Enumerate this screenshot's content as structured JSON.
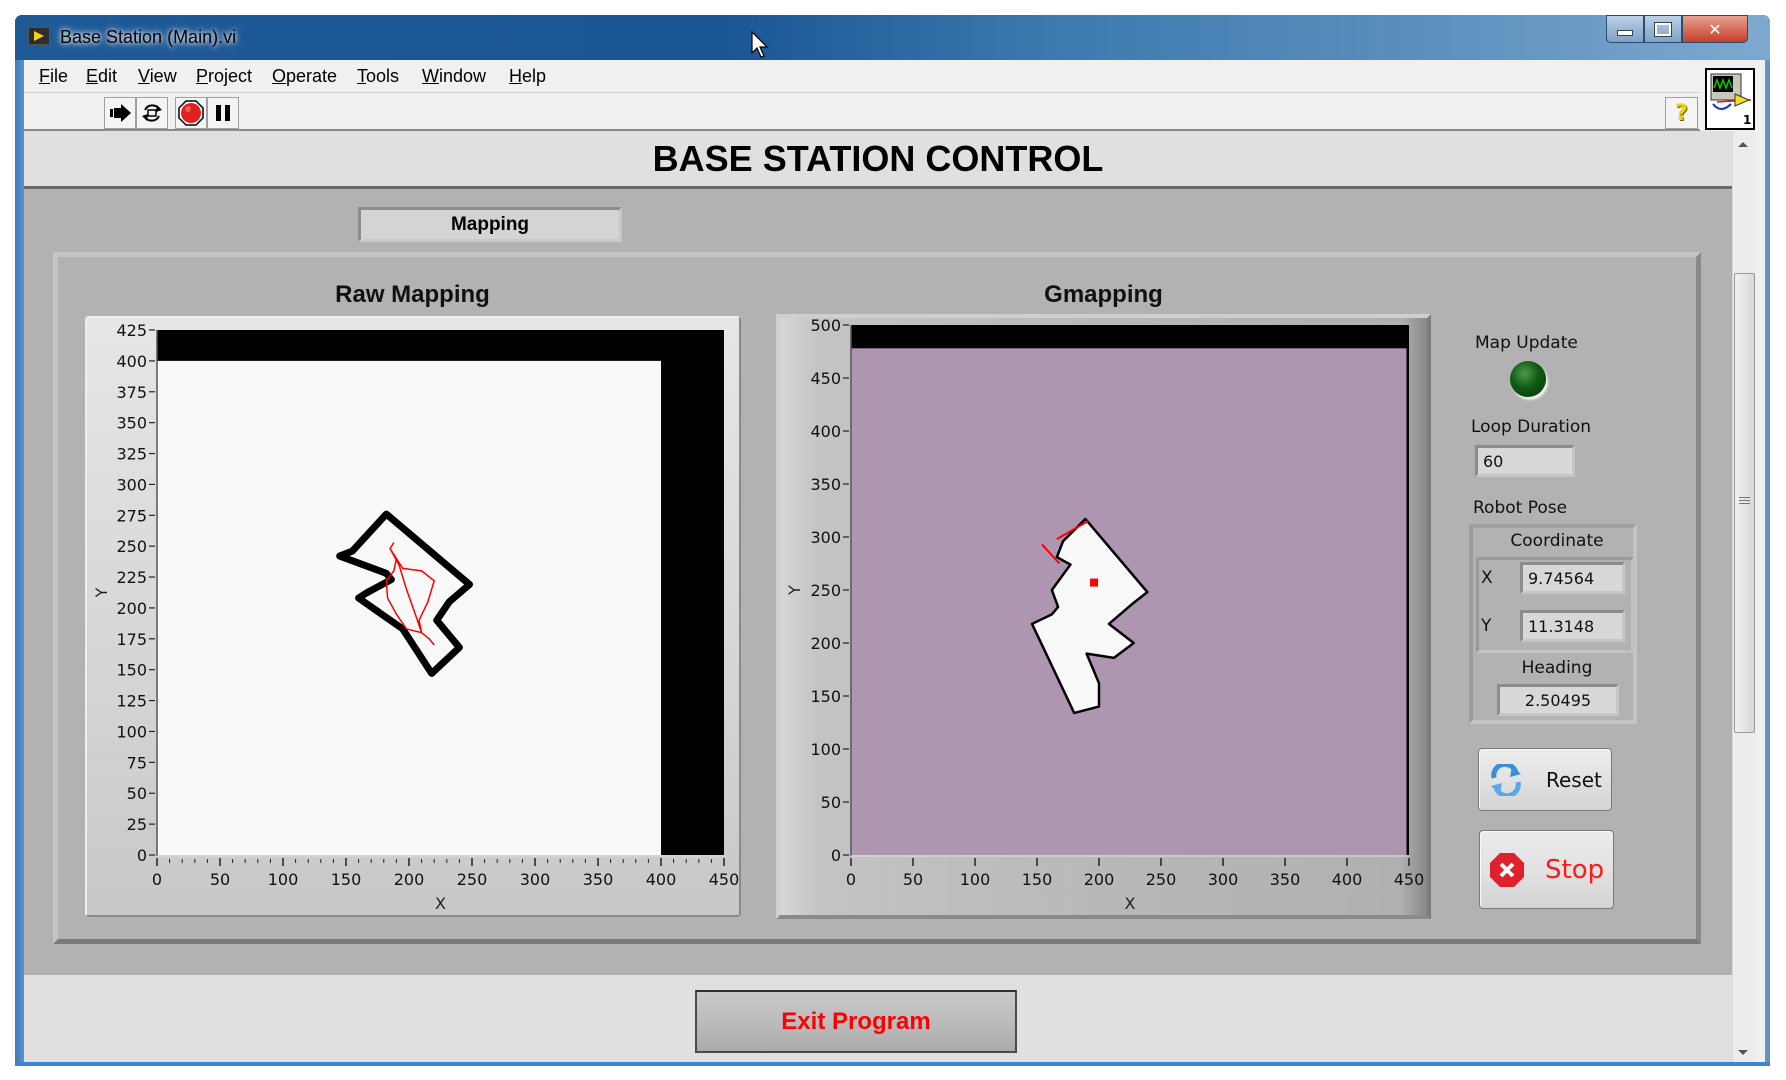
{
  "window": {
    "title": "Base Station (Main).vi",
    "icon": "labview-vi-icon",
    "controls": [
      "minimize",
      "maximize",
      "close"
    ]
  },
  "menu": {
    "items": [
      {
        "label": "File",
        "mnemonic": "F"
      },
      {
        "label": "Edit",
        "mnemonic": "E"
      },
      {
        "label": "View",
        "mnemonic": "V"
      },
      {
        "label": "Project",
        "mnemonic": "P"
      },
      {
        "label": "Operate",
        "mnemonic": "O"
      },
      {
        "label": "Tools",
        "mnemonic": "T"
      },
      {
        "label": "Window",
        "mnemonic": "W"
      },
      {
        "label": "Help",
        "mnemonic": "H"
      }
    ]
  },
  "toolbar": {
    "buttons": [
      {
        "name": "run",
        "icon": "run-arrow-icon"
      },
      {
        "name": "run-continuously",
        "icon": "run-continuously-icon"
      },
      {
        "name": "abort",
        "icon": "abort-stop-icon"
      },
      {
        "name": "pause",
        "icon": "pause-icon"
      }
    ],
    "help_label": "?",
    "vi_icon_number": "1"
  },
  "header": {
    "title": "BASE STATION CONTROL"
  },
  "tabs": [
    {
      "label": "Mapping",
      "selected": true
    }
  ],
  "controls": {
    "map_update": {
      "label": "Map Update",
      "state": "off",
      "color": "#0f5a13"
    },
    "loop_duration": {
      "label": "Loop Duration",
      "value": "60"
    },
    "robot_pose": {
      "label": "Robot Pose",
      "coordinate_label": "Coordinate",
      "x_label": "X",
      "x_value": "9.74564",
      "y_label": "Y",
      "y_value": "11.3148",
      "heading_label": "Heading",
      "heading_value": "2.50495"
    },
    "reset_button": {
      "label": "Reset",
      "icon": "refresh-icon"
    },
    "stop_button": {
      "label": "Stop",
      "icon": "stop-sign-icon",
      "color": "#ff0000"
    },
    "exit_button": {
      "label": "Exit Program",
      "color": "#ff0000"
    }
  },
  "chart_data": [
    {
      "type": "heatmap",
      "title": "Raw Mapping",
      "xlabel": "X",
      "ylabel": "Y",
      "xlim": [
        0,
        450
      ],
      "ylim": [
        0,
        425
      ],
      "x_ticks": [
        "0",
        "50",
        "100",
        "150",
        "200",
        "250",
        "300",
        "350",
        "400",
        "450"
      ],
      "y_ticks": [
        "0",
        "25",
        "50",
        "75",
        "100",
        "125",
        "150",
        "175",
        "200",
        "225",
        "250",
        "275",
        "300",
        "325",
        "350",
        "375",
        "400",
        "425"
      ],
      "x_minor_step": 10,
      "background_color": "#f9f9f9",
      "unmapped_color": "#000000",
      "map_extent": {
        "x": [
          0,
          400
        ],
        "y": [
          0,
          400
        ]
      },
      "obstacle_outline": [
        [
          145,
          242
        ],
        [
          155,
          246
        ],
        [
          182,
          276
        ],
        [
          248,
          219
        ],
        [
          232,
          205
        ],
        [
          222,
          190
        ],
        [
          240,
          168
        ],
        [
          218,
          147
        ],
        [
          195,
          183
        ],
        [
          160,
          208
        ],
        [
          166,
          212
        ],
        [
          186,
          223
        ],
        [
          182,
          228
        ]
      ],
      "trajectory_color": "#ff0000",
      "trajectory": [
        [
          188,
          253
        ],
        [
          185,
          248
        ],
        [
          190,
          240
        ],
        [
          188,
          230
        ],
        [
          182,
          222
        ],
        [
          183,
          208
        ],
        [
          190,
          195
        ],
        [
          198,
          183
        ],
        [
          202,
          182
        ],
        [
          210,
          180
        ],
        [
          208,
          190
        ],
        [
          215,
          205
        ],
        [
          220,
          222
        ],
        [
          210,
          230
        ],
        [
          195,
          232
        ],
        [
          190,
          240
        ],
        [
          185,
          248
        ],
        [
          192,
          235
        ],
        [
          198,
          215
        ],
        [
          205,
          195
        ],
        [
          210,
          180
        ],
        [
          216,
          175
        ],
        [
          220,
          170
        ]
      ]
    },
    {
      "type": "heatmap",
      "title": "Gmapping",
      "xlabel": "X",
      "ylabel": "Y",
      "xlim": [
        0,
        450
      ],
      "ylim": [
        0,
        500
      ],
      "x_ticks": [
        "0",
        "50",
        "100",
        "150",
        "200",
        "250",
        "300",
        "350",
        "400",
        "450"
      ],
      "y_ticks": [
        "0",
        "50",
        "100",
        "150",
        "200",
        "250",
        "300",
        "350",
        "400",
        "450",
        "500"
      ],
      "background_color": "#ae96b0",
      "unmapped_color": "#000000",
      "map_extent": {
        "x": [
          0,
          448
        ],
        "y": [
          0,
          478
        ]
      },
      "free_space_color": "#f9f9f9",
      "free_space_polygon": [
        [
          189,
          317
        ],
        [
          239,
          248
        ],
        [
          228,
          238
        ],
        [
          208,
          218
        ],
        [
          228,
          200
        ],
        [
          212,
          186
        ],
        [
          190,
          190
        ],
        [
          200,
          162
        ],
        [
          200,
          140
        ],
        [
          180,
          134
        ],
        [
          146,
          218
        ],
        [
          162,
          227
        ],
        [
          167,
          234
        ],
        [
          162,
          250
        ],
        [
          177,
          274
        ],
        [
          166,
          281
        ],
        [
          171,
          296
        ]
      ],
      "robot_position": [
        196,
        257
      ],
      "robot_color": "#ff0000",
      "trajectory": [
        [
          154,
          293
        ],
        [
          168,
          275
        ]
      ],
      "trajectory2": [
        [
          166,
          298
        ],
        [
          191,
          315
        ]
      ]
    }
  ]
}
